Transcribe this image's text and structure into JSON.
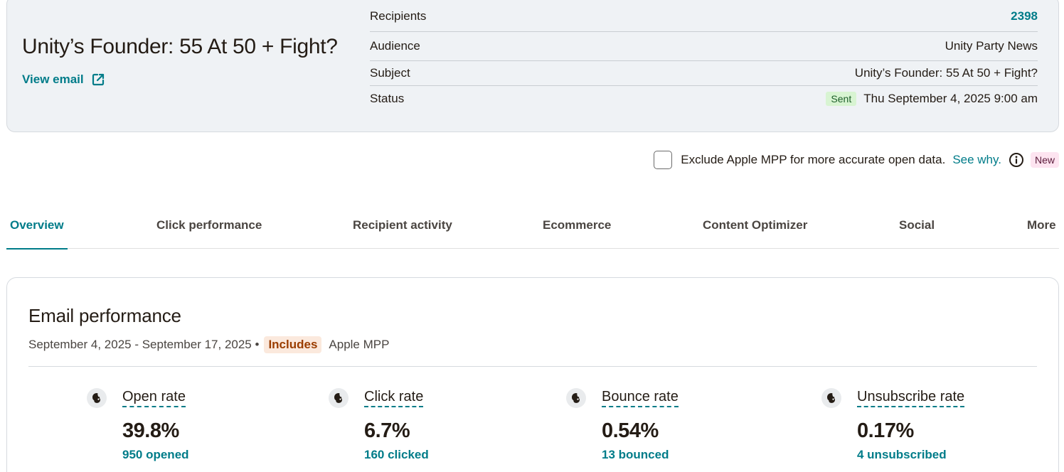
{
  "campaign": {
    "title": "Unity’s Founder: 55 At 50 + Fight?",
    "view_email_label": "View email"
  },
  "details": {
    "recipients_label": "Recipients",
    "recipients_value": "2398",
    "audience_label": "Audience",
    "audience_value": "Unity Party News",
    "subject_label": "Subject",
    "subject_value": "Unity’s Founder: 55 At 50 + Fight?",
    "status_label": "Status",
    "status_badge": "Sent",
    "status_value": "Thu September 4, 2025 9:00 am"
  },
  "mpp": {
    "checkbox_checked": false,
    "text": "Exclude Apple MPP for more accurate open data.",
    "see_why": "See why.",
    "badge": "New"
  },
  "tabs": [
    {
      "label": "Overview",
      "active": true
    },
    {
      "label": "Click performance"
    },
    {
      "label": "Recipient activity"
    },
    {
      "label": "Ecommerce"
    },
    {
      "label": "Content Optimizer"
    },
    {
      "label": "Social"
    },
    {
      "label": "More"
    }
  ],
  "performance": {
    "title": "Email performance",
    "date_range": "September 4, 2025 - September 17, 2025 •",
    "includes_badge": "Includes",
    "includes_text": "Apple MPP",
    "metrics": [
      {
        "label": "Open rate",
        "value": "39.8%",
        "count": "950 opened"
      },
      {
        "label": "Click rate",
        "value": "6.7%",
        "count": "160 clicked"
      },
      {
        "label": "Bounce rate",
        "value": "0.54%",
        "count": "13 bounced"
      },
      {
        "label": "Unsubscribe rate",
        "value": "0.17%",
        "count": "4 unsubscribed"
      }
    ]
  },
  "colors": {
    "accent": "#007c89",
    "card_bg": "#eff2f5",
    "sent_badge_bg": "#d8f4d2",
    "new_badge_bg": "#fde4f0",
    "includes_badge_bg": "#fbe9dd"
  },
  "icons": {
    "view_email": "external-link-icon",
    "info": "info-icon",
    "metric": "mailchimp-freddie-icon"
  }
}
